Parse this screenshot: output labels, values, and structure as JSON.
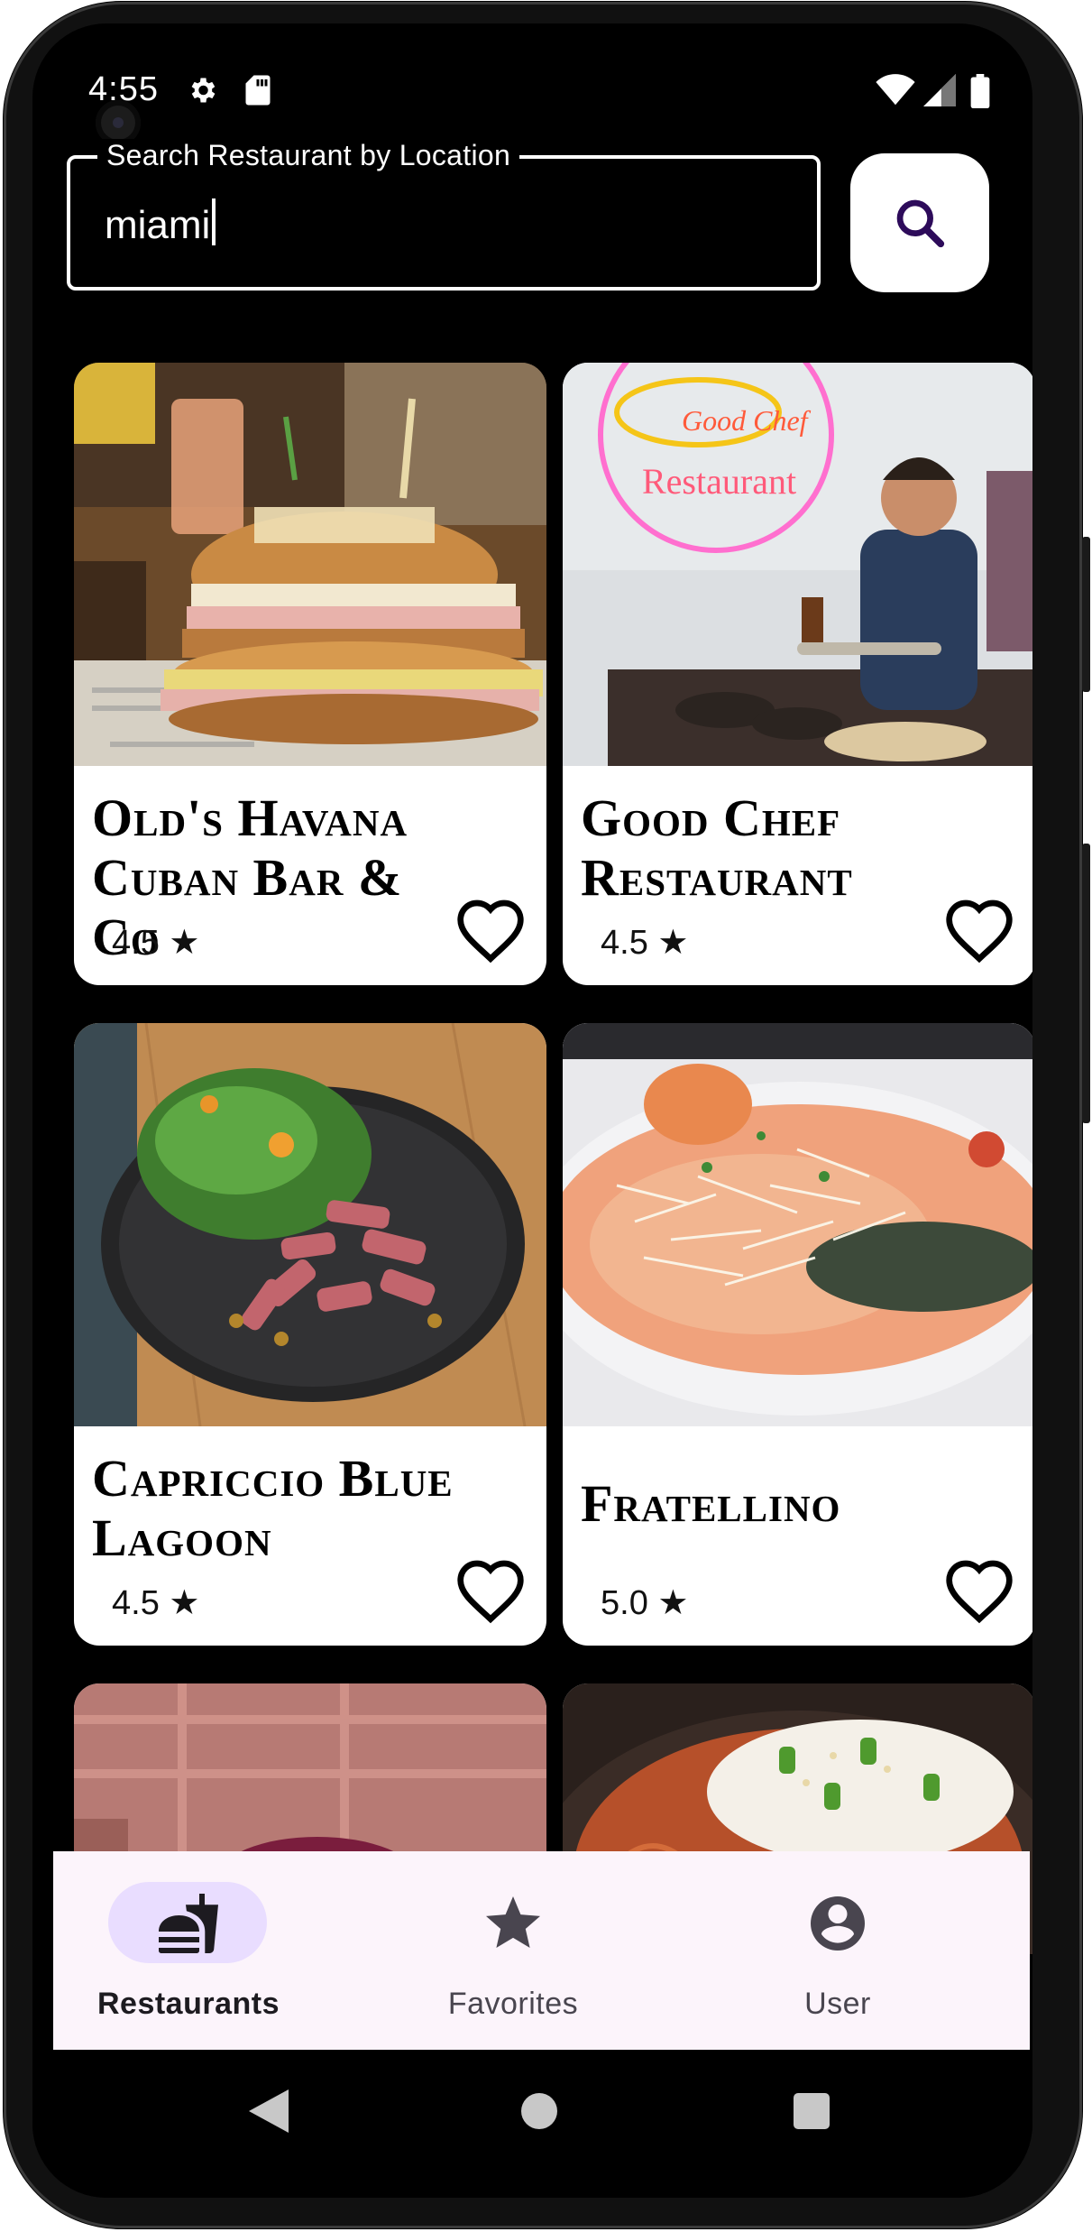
{
  "status_bar": {
    "time": "4:55",
    "icons": [
      "gear-icon",
      "sd-card-icon",
      "wifi-icon",
      "cellular-icon",
      "battery-icon"
    ]
  },
  "search": {
    "label": "Search Restaurant by Location",
    "value": "miami",
    "button_icon": "search-icon"
  },
  "restaurants": [
    {
      "name": "Old's Havana Cuban Bar & Co",
      "rating": "4.5 ★",
      "favorite": false
    },
    {
      "name": "Good Chef Restaurant",
      "rating": "4.5 ★",
      "favorite": false
    },
    {
      "name": "Capriccio Blue Lagoon",
      "rating": "4.5 ★",
      "favorite": false
    },
    {
      "name": "Fratellino",
      "rating": "5.0 ★",
      "favorite": false
    }
  ],
  "photo_signs": {
    "neon_line1": "Good Chef",
    "neon_line2": "Restaurant"
  },
  "bottom_nav": {
    "items": [
      {
        "label": "Restaurants",
        "icon": "fastfood-icon",
        "active": true
      },
      {
        "label": "Favorites",
        "icon": "star-icon",
        "active": false
      },
      {
        "label": "User",
        "icon": "account-circle-icon",
        "active": false
      }
    ]
  },
  "system_nav": [
    "back-icon",
    "home-icon",
    "recents-icon"
  ],
  "colors": {
    "background": "#000000",
    "card": "#ffffff",
    "nav_bar": "#fcf4fb",
    "active_pill": "#e9ddff",
    "search_icon": "#2d0b5a"
  }
}
